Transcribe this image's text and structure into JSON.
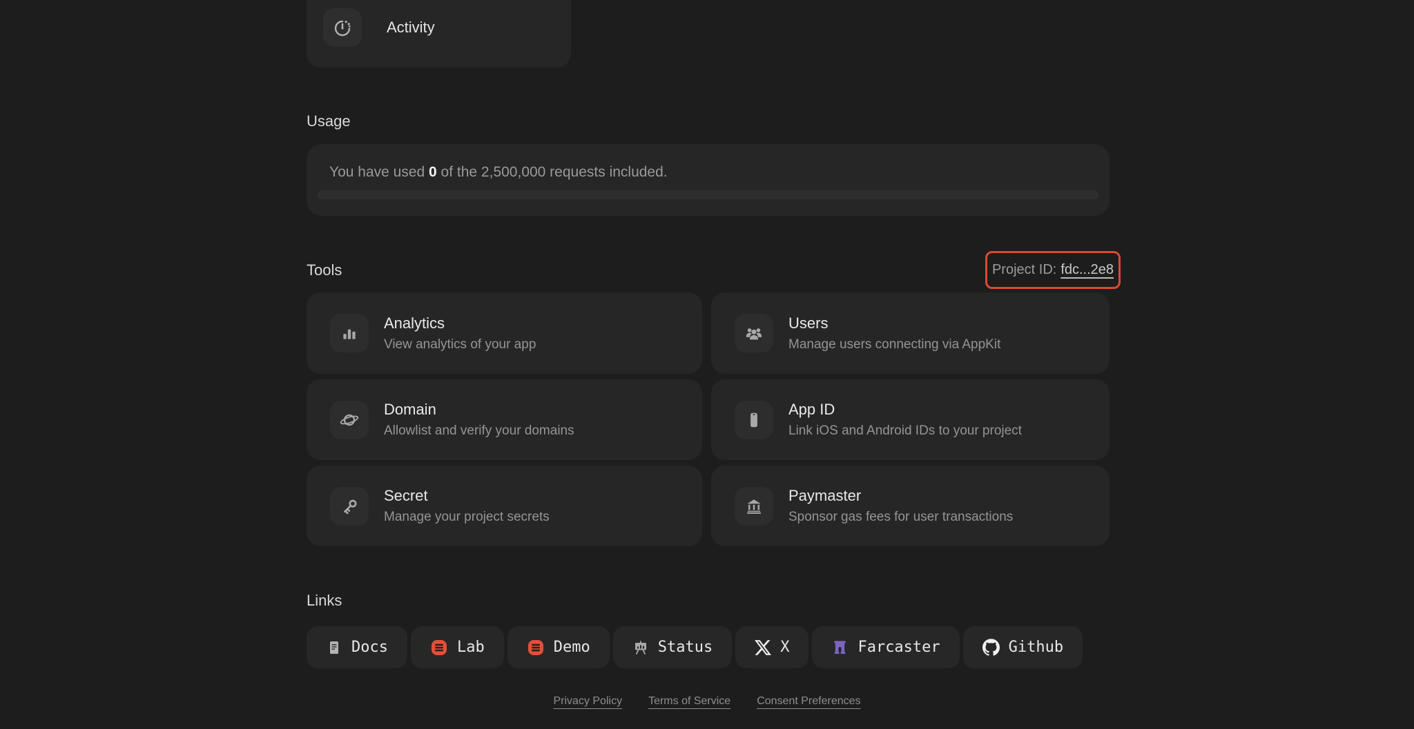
{
  "activity_card": {
    "label": "Activity",
    "icon": "timer-icon"
  },
  "usage": {
    "heading": "Usage",
    "text_prefix": "You have used ",
    "used_value": "0",
    "text_suffix": " of the 2,500,000 requests included.",
    "progress_percent": 0
  },
  "tools": {
    "heading": "Tools",
    "project_id": {
      "label": "Project ID:",
      "value": "fdc...2e8",
      "highlight_color": "#e1492e"
    },
    "cards": [
      {
        "title": "Analytics",
        "subtitle": "View analytics of your app",
        "icon": "bar-chart-icon"
      },
      {
        "title": "Users",
        "subtitle": "Manage users connecting via AppKit",
        "icon": "users-icon"
      },
      {
        "title": "Domain",
        "subtitle": "Allowlist and verify your domains",
        "icon": "planet-icon"
      },
      {
        "title": "App ID",
        "subtitle": "Link iOS and Android IDs to your project",
        "icon": "phone-icon"
      },
      {
        "title": "Secret",
        "subtitle": "Manage your project secrets",
        "icon": "key-icon"
      },
      {
        "title": "Paymaster",
        "subtitle": "Sponsor gas fees for user transactions",
        "icon": "bank-icon"
      }
    ]
  },
  "links": {
    "heading": "Links",
    "items": [
      {
        "label": "Docs",
        "icon": "docs-icon"
      },
      {
        "label": "Lab",
        "icon": "lab-icon",
        "icon_color": "#e2503a"
      },
      {
        "label": "Demo",
        "icon": "demo-icon",
        "icon_color": "#e2503a"
      },
      {
        "label": "Status",
        "icon": "status-icon"
      },
      {
        "label": "X",
        "icon": "x-logo-icon"
      },
      {
        "label": "Farcaster",
        "icon": "farcaster-icon",
        "icon_color": "#7c65c1"
      },
      {
        "label": "Github",
        "icon": "github-icon"
      }
    ]
  },
  "footer": {
    "links": [
      "Privacy Policy",
      "Terms of Service",
      "Consent Preferences"
    ]
  },
  "colors": {
    "page_background": "#1d1d1d",
    "card_background": "#262626",
    "icon_box_background": "#2d2d2d",
    "primary_text": "#eaeaea",
    "secondary_text": "#959595",
    "project_id_border": "#e1492e",
    "lab_demo_icon": "#e2503a",
    "farcaster_purple": "#7c65c1"
  }
}
